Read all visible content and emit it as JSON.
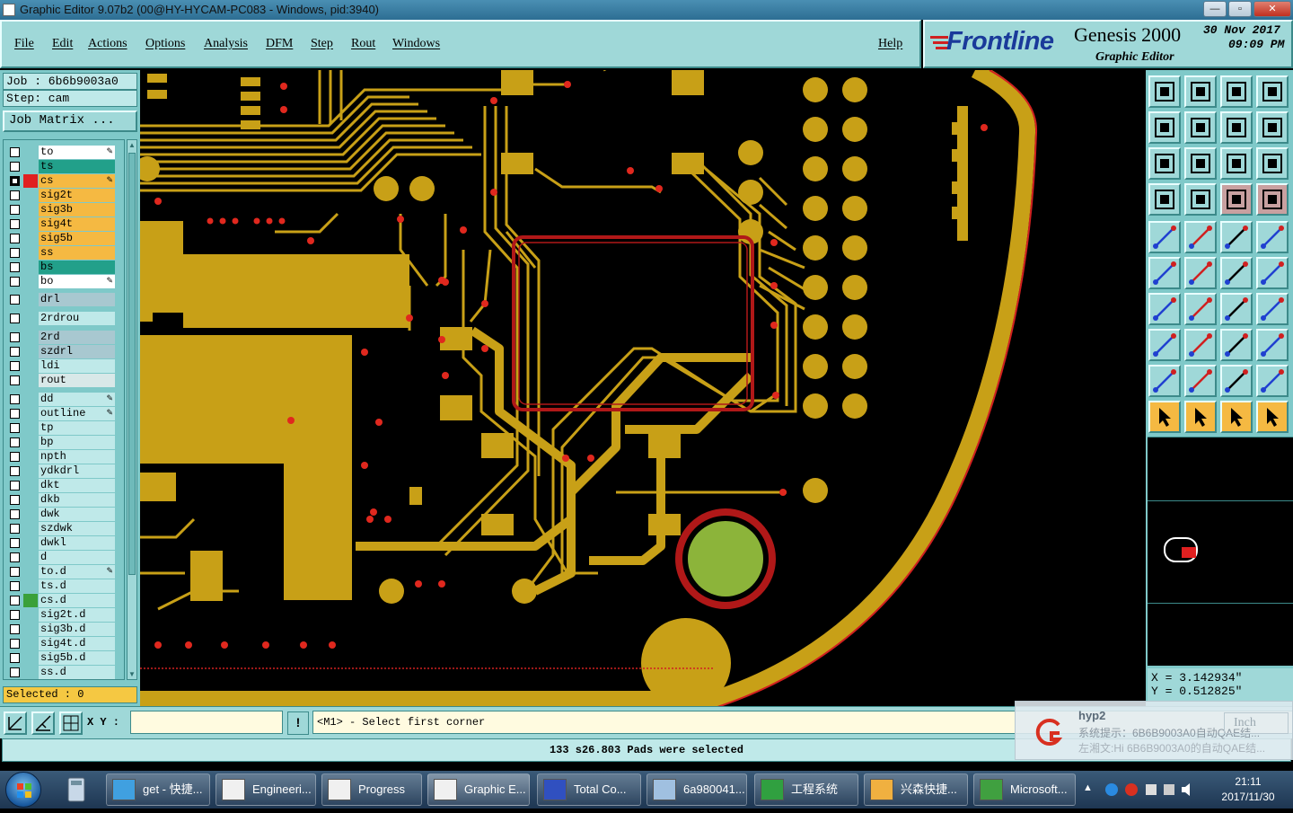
{
  "window": {
    "title": "Graphic Editor 9.07b2 (00@HY-HYCAM-PC083 - Windows, pid:3940)",
    "controls": [
      "—",
      "▫",
      "✕"
    ]
  },
  "menu": {
    "items": [
      "File",
      "Edit",
      "Actions",
      "Options",
      "Analysis",
      "DFM",
      "Step",
      "Rout",
      "Windows"
    ],
    "help": "Help"
  },
  "brand": {
    "logo": "Frontline",
    "product": "Genesis 2000",
    "subtitle": "Graphic Editor",
    "date": "30 Nov 2017",
    "time": "09:09 PM"
  },
  "job": {
    "job_line": "Job : 6b6b9003a0",
    "step_line": "Step: cam",
    "matrix_button": "Job Matrix ..."
  },
  "layers": [
    {
      "name": "to",
      "color": "#ffffff",
      "swatch": "",
      "pen": true,
      "selected": false
    },
    {
      "name": "ts",
      "color": "#22a08a",
      "swatch": "",
      "pen": false,
      "selected": false
    },
    {
      "name": "cs",
      "color": "#f5b942",
      "swatch": "#e02020",
      "pen": true,
      "selected": true
    },
    {
      "name": "sig2t",
      "color": "#f5b942",
      "swatch": "",
      "pen": false,
      "selected": false
    },
    {
      "name": "sig3b",
      "color": "#f5b942",
      "swatch": "",
      "pen": false,
      "selected": false
    },
    {
      "name": "sig4t",
      "color": "#f5b942",
      "swatch": "",
      "pen": false,
      "selected": false
    },
    {
      "name": "sig5b",
      "color": "#f5b942",
      "swatch": "",
      "pen": false,
      "selected": false
    },
    {
      "name": "ss",
      "color": "#f5b942",
      "swatch": "",
      "pen": false,
      "selected": false
    },
    {
      "name": "bs",
      "color": "#22a08a",
      "swatch": "",
      "pen": false,
      "selected": false
    },
    {
      "name": "bo",
      "color": "#ffffff",
      "swatch": "",
      "pen": true,
      "selected": false
    },
    {
      "name": "drl",
      "color": "#a8c8d0",
      "swatch": "",
      "pen": false,
      "selected": false
    },
    {
      "name": "2rdrou",
      "color": "#bfe9e9",
      "swatch": "",
      "pen": false,
      "selected": false
    },
    {
      "name": "2rd",
      "color": "#a8c8d0",
      "swatch": "",
      "pen": false,
      "selected": false
    },
    {
      "name": "szdrl",
      "color": "#a8c8d0",
      "swatch": "",
      "pen": false,
      "selected": false
    },
    {
      "name": "ldi",
      "color": "#bfe9e9",
      "swatch": "",
      "pen": false,
      "selected": false
    },
    {
      "name": "rout",
      "color": "#d8e8e8",
      "swatch": "",
      "pen": false,
      "selected": false
    },
    {
      "name": "dd",
      "color": "#bfe9e9",
      "swatch": "",
      "pen": true,
      "selected": false
    },
    {
      "name": "outline",
      "color": "#bfe9e9",
      "swatch": "",
      "pen": true,
      "selected": false
    },
    {
      "name": "tp",
      "color": "#bfe9e9",
      "swatch": "",
      "pen": false,
      "selected": false
    },
    {
      "name": "bp",
      "color": "#bfe9e9",
      "swatch": "",
      "pen": false,
      "selected": false
    },
    {
      "name": "npth",
      "color": "#bfe9e9",
      "swatch": "",
      "pen": false,
      "selected": false
    },
    {
      "name": "ydkdrl",
      "color": "#bfe9e9",
      "swatch": "",
      "pen": false,
      "selected": false
    },
    {
      "name": "dkt",
      "color": "#bfe9e9",
      "swatch": "",
      "pen": false,
      "selected": false
    },
    {
      "name": "dkb",
      "color": "#bfe9e9",
      "swatch": "",
      "pen": false,
      "selected": false
    },
    {
      "name": "dwk",
      "color": "#bfe9e9",
      "swatch": "",
      "pen": false,
      "selected": false
    },
    {
      "name": "szdwk",
      "color": "#bfe9e9",
      "swatch": "",
      "pen": false,
      "selected": false
    },
    {
      "name": "dwkl",
      "color": "#bfe9e9",
      "swatch": "",
      "pen": false,
      "selected": false
    },
    {
      "name": "d",
      "color": "#bfe9e9",
      "swatch": "",
      "pen": false,
      "selected": false
    },
    {
      "name": "to.d",
      "color": "#bfe9e9",
      "swatch": "",
      "pen": true,
      "selected": false
    },
    {
      "name": "ts.d",
      "color": "#bfe9e9",
      "swatch": "",
      "pen": false,
      "selected": false
    },
    {
      "name": "cs.d",
      "color": "#bfe9e9",
      "swatch": "#3aa03a",
      "pen": false,
      "selected": false
    },
    {
      "name": "sig2t.d",
      "color": "#bfe9e9",
      "swatch": "",
      "pen": false,
      "selected": false
    },
    {
      "name": "sig3b.d",
      "color": "#bfe9e9",
      "swatch": "",
      "pen": false,
      "selected": false
    },
    {
      "name": "sig4t.d",
      "color": "#bfe9e9",
      "swatch": "",
      "pen": false,
      "selected": false
    },
    {
      "name": "sig5b.d",
      "color": "#bfe9e9",
      "swatch": "",
      "pen": false,
      "selected": false
    },
    {
      "name": "ss.d",
      "color": "#bfe9e9",
      "swatch": "",
      "pen": false,
      "selected": false
    }
  ],
  "selected_count": "Selected : 0",
  "coords": {
    "x": "X = 3.142934\"",
    "y": "Y = 0.512825\""
  },
  "command": {
    "xy_label": "X Y :",
    "xy_value": "",
    "excl": "!",
    "prompt": "<M1> - Select first corner"
  },
  "status": "133 s26.803 Pads were selected",
  "notification": {
    "title": "hyp2",
    "line1": "系统提示：6B6B9003A0自动QAE结...",
    "line2": "左湘文:Hi 6B6B9003A0的自动QAE结...",
    "unit": "Inch"
  },
  "taskbar": {
    "items": [
      "get - 快捷...",
      "Engineeri...",
      "Progress",
      "Graphic E...",
      "Total Co...",
      "6a980041...",
      "工程系统",
      "兴森快捷...",
      "Microsoft..."
    ],
    "time": "21:11",
    "date": "2017/11/30"
  },
  "colors": {
    "copper": "#c8a017",
    "background": "#000000",
    "panel": "#9fd8d8",
    "selection_highlight": "#e02020"
  }
}
